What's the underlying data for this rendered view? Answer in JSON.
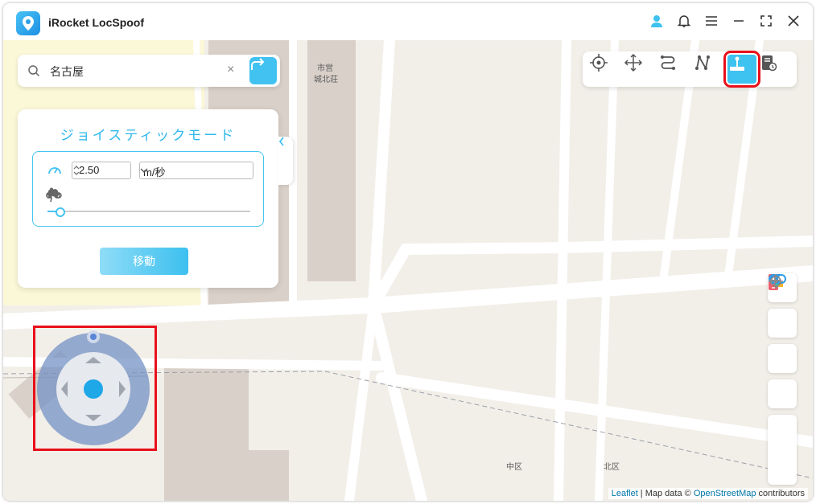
{
  "app": {
    "title": "iRocket LocSpoof"
  },
  "titlebar_icons": [
    "user-icon",
    "bell-icon",
    "menu-icon",
    "minimize-icon",
    "maximize-icon",
    "close-icon"
  ],
  "search": {
    "value": "名古屋",
    "placeholder": ""
  },
  "panel": {
    "title": "ジョイスティックモード",
    "speed_value": "2.50",
    "speed_unit": "m/秒",
    "speed_level": 0.06,
    "move_button": "移動"
  },
  "map_labels": {
    "label1": "市営",
    "label2": "城北荘",
    "label3": "中区",
    "label4": "北区"
  },
  "attribution": {
    "leaflet": "Leaflet",
    "sep1": " | Map data © ",
    "osm": "OpenStreetMap",
    "tail": " contributors"
  },
  "colors": {
    "accent": "#3ec2ef",
    "highlight": "#e8101a"
  }
}
